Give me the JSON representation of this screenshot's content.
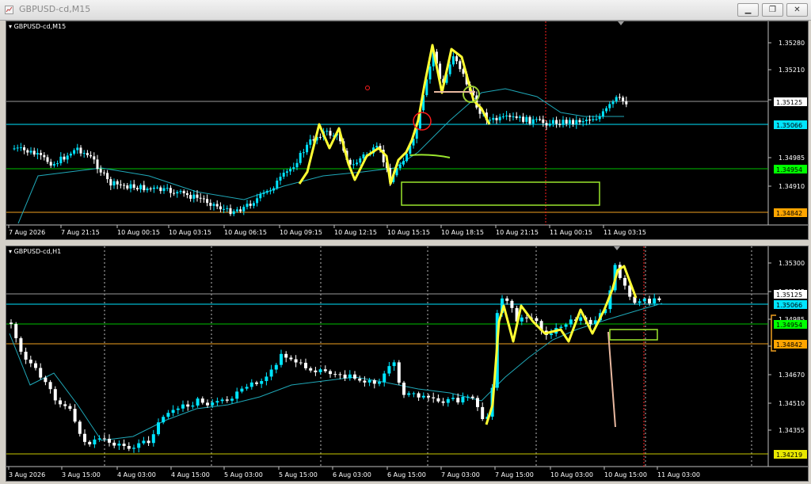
{
  "window": {
    "title": "GBPUSD-cd,M15"
  },
  "colors": {
    "bg": "#000000",
    "bull": "#00e5ff",
    "bear": "#ffffff",
    "ma": "#1fa8b8",
    "highlight": "#ffff33",
    "green_line": "#00c000",
    "orange_line": "#f0a020",
    "yellow_line": "#c8c800",
    "box": "#9be62e",
    "red_vline": "#ff2020",
    "circle_red": "#ff1c1c",
    "circle_green": "#9acd32",
    "salmon": "#e8b8a0"
  },
  "top_chart": {
    "symbol_label": "GBPUSD-cd,M15",
    "price_labels": [
      "1.35280",
      "1.35210",
      "1.35125",
      "1.34985",
      "1.34910"
    ],
    "level_badges": [
      {
        "value": "1.35125",
        "style": "white"
      },
      {
        "value": "1.35066",
        "style": "cyan"
      },
      {
        "value": "1.34954",
        "style": "green"
      },
      {
        "value": "1.34842",
        "style": "orange"
      }
    ],
    "time_labels": [
      "7 Aug 2026",
      "7 Aug 21:15",
      "10 Aug 00:15",
      "10 Aug 03:15",
      "10 Aug 06:15",
      "10 Aug 09:15",
      "10 Aug 12:15",
      "10 Aug 15:15",
      "10 Aug 18:15",
      "10 Aug 21:15",
      "11 Aug 00:15",
      "11 Aug 03:15"
    ]
  },
  "bottom_chart": {
    "symbol_label": "GBPUSD-cd,H1",
    "price_labels": [
      "1.35300",
      "1.35145",
      "1.34985",
      "1.34825",
      "1.34670",
      "1.34510",
      "1.34355"
    ],
    "level_badges": [
      {
        "value": "1.35125",
        "style": "white"
      },
      {
        "value": "1.35066",
        "style": "cyan"
      },
      {
        "value": "1.34954",
        "style": "green"
      },
      {
        "value": "1.34842",
        "style": "orange"
      },
      {
        "value": "1.34219",
        "style": "yellow"
      }
    ],
    "time_labels": [
      "3 Aug 2026",
      "3 Aug 15:00",
      "4 Aug 03:00",
      "4 Aug 15:00",
      "5 Aug 03:00",
      "5 Aug 15:00",
      "6 Aug 03:00",
      "6 Aug 15:00",
      "7 Aug 03:00",
      "7 Aug 15:00",
      "10 Aug 03:00",
      "10 Aug 15:00",
      "11 Aug 03:00"
    ]
  }
}
